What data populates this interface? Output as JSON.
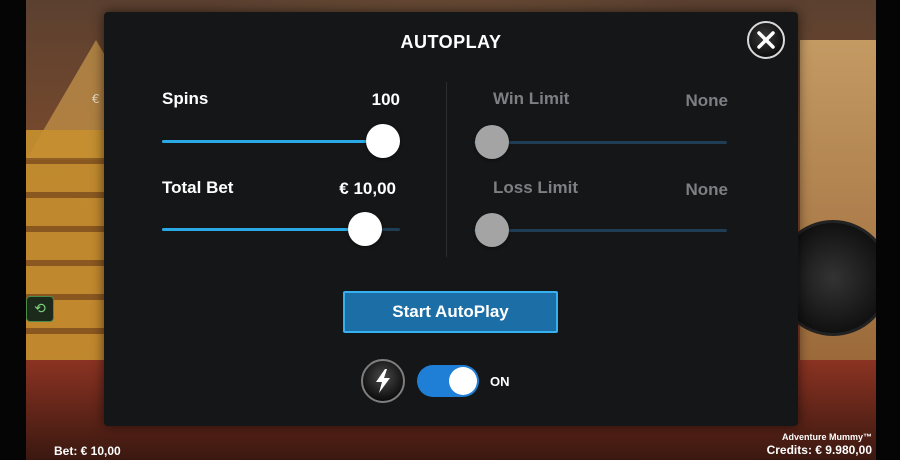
{
  "modal": {
    "title": "AUTOPLAY",
    "start_button_label": "Start AutoPlay",
    "close_icon": "close-icon",
    "turbo_icon": "lightning-icon",
    "toggle_label": "ON",
    "toggle_on": true
  },
  "controls": {
    "spins": {
      "label": "Spins",
      "value": "100",
      "level": 1.0,
      "enabled": true
    },
    "total_bet": {
      "label": "Total Bet",
      "value": "€ 10,00",
      "level": 0.92,
      "enabled": true
    },
    "win_limit": {
      "label": "Win Limit",
      "value": "None",
      "level": 0.0,
      "enabled": false
    },
    "loss_limit": {
      "label": "Loss Limit",
      "value": "None",
      "level": 0.0,
      "enabled": false
    }
  },
  "footer": {
    "bet": "Bet: € 10,00",
    "game_name": "Adventure Mummy™",
    "credits": "Credits: € 9.980,00"
  },
  "background": {
    "euro_tag": "€",
    "replay_icon": "replay-icon"
  },
  "colors": {
    "accent": "#29a9e6",
    "modal_bg": "#151617",
    "button_bg": "#1b6fa6",
    "toggle_bg": "#1f7fd6"
  }
}
